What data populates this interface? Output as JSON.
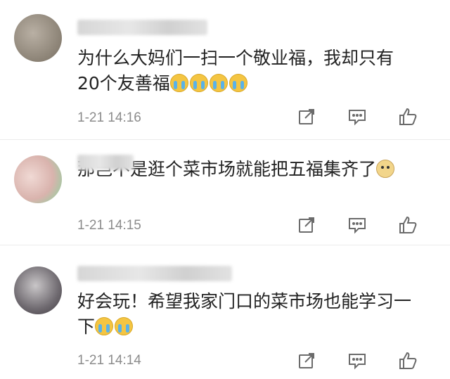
{
  "comments": [
    {
      "text": "为什么大妈们一扫一个敬业福，我却只有\n20个友善福",
      "emojis": [
        "cry",
        "cry",
        "cry",
        "cry"
      ],
      "time": "1-21 14:16"
    },
    {
      "text": "那岂不是逛个菜市场就能把五福集齐了",
      "emojis": [
        "dog"
      ],
      "time": "1-21 14:15"
    },
    {
      "text": "好会玩！希望我家门口的菜市场也能学习一\n下",
      "emojis": [
        "cry-laugh",
        "cry-laugh"
      ],
      "time": "1-21 14:14"
    }
  ],
  "icons": [
    "share-icon",
    "reply-icon",
    "like-icon"
  ]
}
